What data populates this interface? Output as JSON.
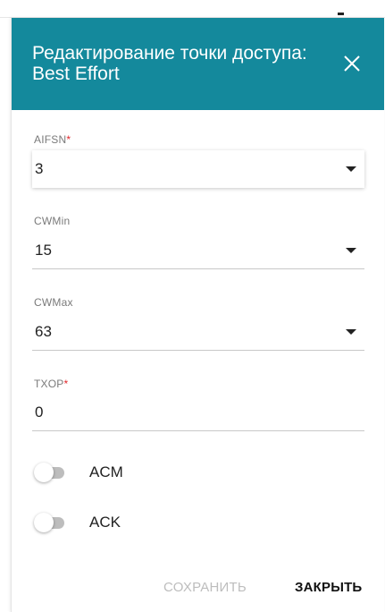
{
  "dialog": {
    "title": "Редактирование точки доступа: Best Effort",
    "header_color": "#14899c",
    "close_icon": "close-icon"
  },
  "fields": {
    "aifsn": {
      "label": "AIFSN",
      "required_mark": "*",
      "value": "3"
    },
    "cwmin": {
      "label": "CWMin",
      "value": "15"
    },
    "cwmax": {
      "label": "CWMax",
      "value": "63"
    },
    "txop": {
      "label": "TXOP",
      "required_mark": "*",
      "value": "0"
    }
  },
  "toggles": {
    "acm": {
      "label": "ACM",
      "on": false
    },
    "ack": {
      "label": "ACK",
      "on": false
    }
  },
  "footer": {
    "save_label": "СОХРАНИТЬ",
    "close_label": "ЗАКРЫТЬ"
  },
  "colors": {
    "required": "#e0262a",
    "disabled_text": "#bdbdbd"
  }
}
